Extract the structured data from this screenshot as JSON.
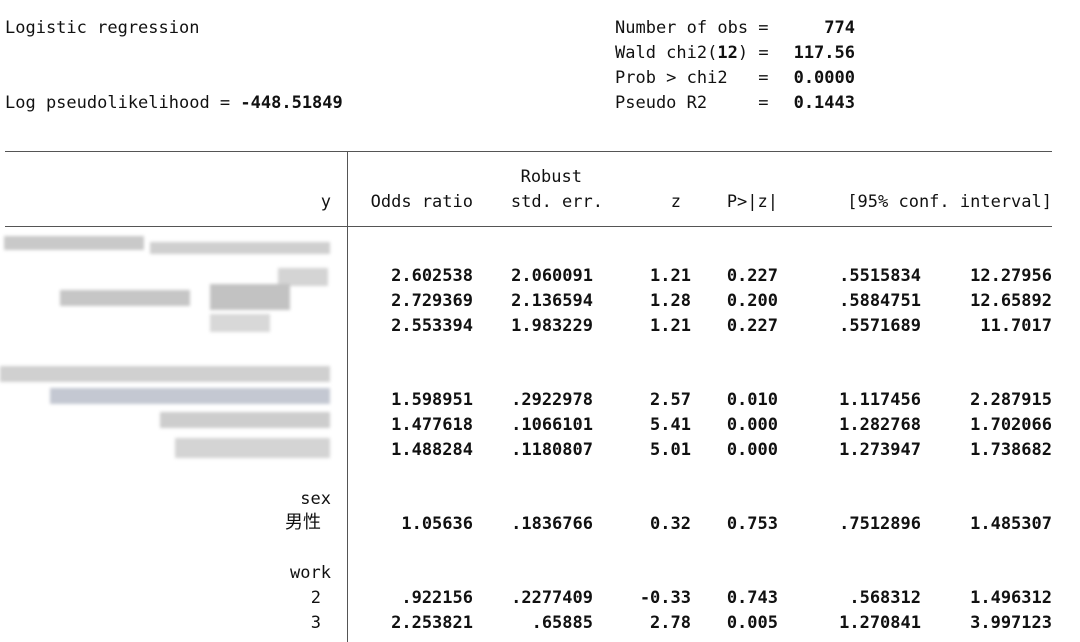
{
  "header": {
    "title": "Logistic regression",
    "loglik_label": "Log pseudolikelihood = ",
    "loglik_value": "-448.51849",
    "stats": [
      {
        "label": "Number of obs =",
        "value": "774"
      },
      {
        "label": "Wald chi2(",
        "label_num": "12",
        "label_end": ") =",
        "value": "117.56"
      },
      {
        "label": "Prob > chi2   =",
        "value": "0.0000"
      },
      {
        "label": "Pseudo R2     =",
        "value": "0.1443"
      }
    ]
  },
  "columns": {
    "depvar": "y",
    "odds_ratio": "Odds ratio",
    "robust": "Robust",
    "std_err": "std. err.",
    "z": "z",
    "p": "P>|z|",
    "ci": "[95% conf. interval]"
  },
  "groups": [
    {
      "rows": [
        {
          "or": "2.602538",
          "se": "2.060091",
          "z": "1.21",
          "p": "0.227",
          "lo": ".5515834",
          "hi": "12.27956"
        },
        {
          "or": "2.729369",
          "se": "2.136594",
          "z": "1.28",
          "p": "0.200",
          "lo": ".5884751",
          "hi": "12.65892"
        },
        {
          "or": "2.553394",
          "se": "1.983229",
          "z": "1.21",
          "p": "0.227",
          "lo": ".5571689",
          "hi": "11.7017"
        }
      ]
    },
    {
      "rows": [
        {
          "or": "1.598951",
          "se": ".2922978",
          "z": "2.57",
          "p": "0.010",
          "lo": "1.117456",
          "hi": "2.287915"
        },
        {
          "or": "1.477618",
          "se": ".1066101",
          "z": "5.41",
          "p": "0.000",
          "lo": "1.282768",
          "hi": "1.702066"
        },
        {
          "or": "1.488284",
          "se": ".1180807",
          "z": "5.01",
          "p": "0.000",
          "lo": "1.273947",
          "hi": "1.738682"
        }
      ]
    },
    {
      "name": "sex",
      "rows": [
        {
          "label": "男性",
          "or": "1.05636",
          "se": ".1836766",
          "z": "0.32",
          "p": "0.753",
          "lo": ".7512896",
          "hi": "1.485307"
        }
      ]
    },
    {
      "name": "work",
      "rows": [
        {
          "label": "2",
          "or": ".922156",
          "se": ".2277409",
          "z": "-0.33",
          "p": "0.743",
          "lo": ".568312",
          "hi": "1.496312"
        },
        {
          "label": "3",
          "or": "2.253821",
          "se": ".65885",
          "z": "2.78",
          "p": "0.005",
          "lo": "1.270841",
          "hi": "3.997123"
        }
      ]
    }
  ]
}
